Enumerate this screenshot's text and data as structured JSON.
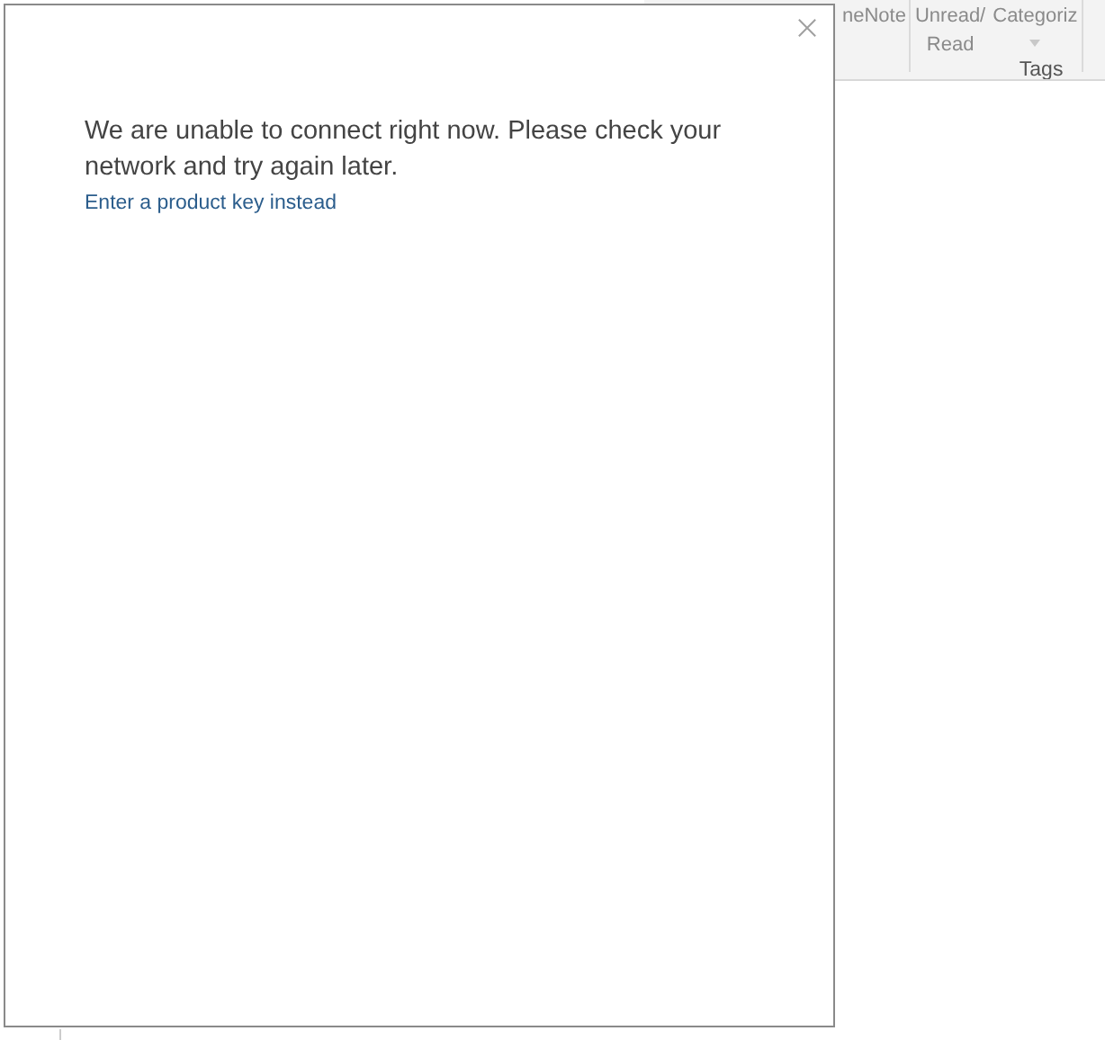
{
  "ribbon": {
    "groups": [
      {
        "buttons": [
          {
            "label": "neNote"
          }
        ]
      },
      {
        "buttons": [
          {
            "label": "Unread/\nRead"
          },
          {
            "label": "Categoriz",
            "caret": true
          }
        ],
        "title": "Tags"
      }
    ]
  },
  "dialog": {
    "message": "We are unable to connect right now. Please check your network and try again later.",
    "link": "Enter a product key instead"
  }
}
